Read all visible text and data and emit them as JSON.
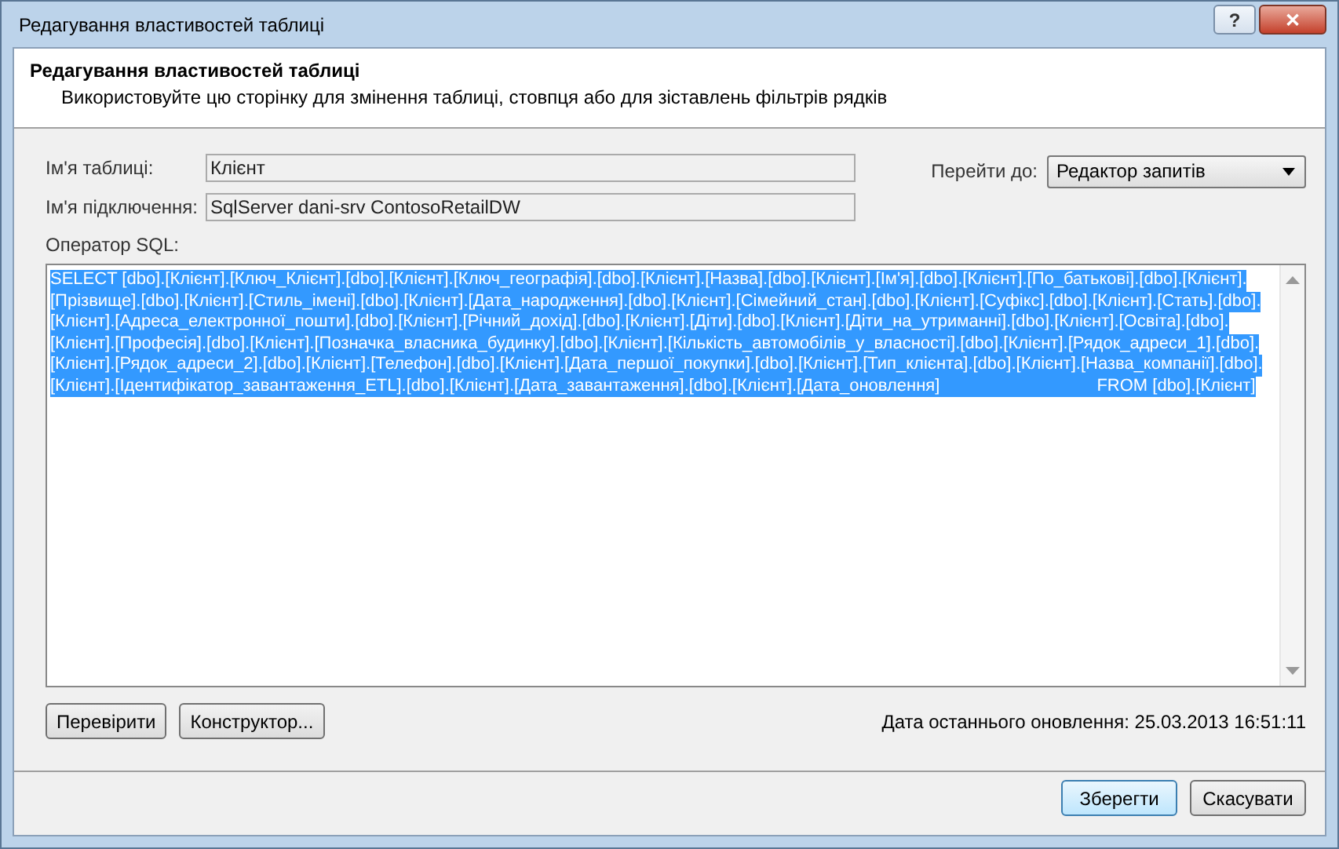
{
  "window": {
    "title": "Редагування властивостей таблиці",
    "buttons": [
      "?",
      "✕"
    ]
  },
  "header": {
    "title": "Редагування властивостей таблиці",
    "description": "Використовуйте цю сторінку для змінення таблиці, стовпця або для зіставлень фільтрів рядків"
  },
  "fields": [
    {
      "label": "Ім'я таблиці:",
      "value": "Клієнт"
    },
    {
      "label": "Ім'я підключення:",
      "value": "SqlServer dani-srv ContosoRetailDW"
    }
  ],
  "goto": {
    "label": "Перейти до:",
    "value": "Редактор запитів"
  },
  "sql": {
    "label": "Оператор SQL:",
    "selected": true,
    "lines": [
      "SELECT [dbo].[Клієнт].[Ключ_Клієнт].[dbo].[Клієнт].[Ключ_географія].[dbo].[Клієнт].[Назва].[dbo].[Клієнт].[Ім'я].[dbo].[Клієнт].[По_батькові].[dbo].[Клієнт].",
      "[Прізвище].[dbo].[Клієнт].[Стиль_імені].[dbo].[Клієнт].[Дата_народження].[dbo].[Клієнт].[Сімейний_стан].[dbo].[Клієнт].[Суфікс].[dbo].[Клієнт].[Стать].[dbo].",
      "[Клієнт].[Адреса_електронної_пошти].[dbo].[Клієнт].[Річний_дохід].[dbo].[Клієнт].[Діти].[dbo].[Клієнт].[Діти_на_утриманні].[dbo].[Клієнт].[Освіта].[dbo].",
      "[Клієнт].[Професія].[dbo].[Клієнт].[Позначка_власника_будинку].[dbo].[Клієнт].[Кількість_автомобілів_у_власності].[dbo].[Клієнт].[Рядок_адреси_1].[dbo].",
      "[Клієнт].[Рядок_адреси_2].[dbo].[Клієнт].[Телефон].[dbo].[Клієнт].[Дата_першої_покупки].[dbo].[Клієнт].[Тип_клієнта].[dbo].[Клієнт].[Назва_компанії].[dbo].",
      "[Клієнт].[Ідентифікатор_завантаження_ETL].[dbo].[Клієнт].[Дата_завантаження].[dbo].[Клієнт].[Дата_оновлення]"
    ],
    "tail": "FROM [dbo].[Клієнт]"
  },
  "tools": [
    "Перевірити",
    "Конструктор..."
  ],
  "last_update": "Дата останнього оновлення: 25.03.2013 16:51:11",
  "footer_buttons": [
    {
      "label": "Зберегти",
      "default": true
    },
    {
      "label": "Скасувати",
      "default": false
    }
  ]
}
